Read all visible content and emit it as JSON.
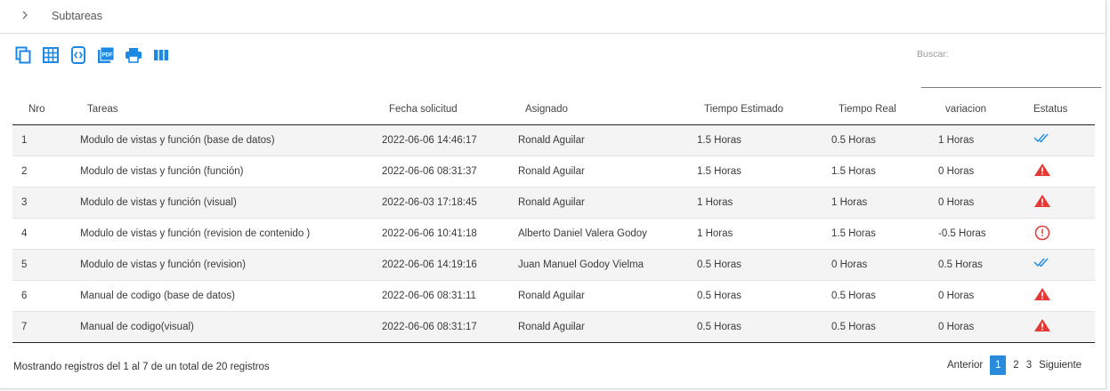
{
  "panel": {
    "title": "Subtareas"
  },
  "toolbar": {
    "buttons": [
      {
        "icon": "copy-icon"
      },
      {
        "icon": "excel-icon"
      },
      {
        "icon": "csv-icon"
      },
      {
        "icon": "pdf-icon"
      },
      {
        "icon": "print-icon"
      },
      {
        "icon": "columns-icon"
      }
    ],
    "accent": "#1e88e5"
  },
  "search": {
    "label": "Buscar:",
    "value": ""
  },
  "table": {
    "headers": [
      "Nro",
      "Tareas",
      "Fecha solicitud",
      "Asignado",
      "Tiempo Estimado",
      "Tiempo Real",
      "variacion",
      "Estatus"
    ],
    "rows": [
      {
        "nro": "1",
        "tarea": "Modulo de vistas y función (base de datos)",
        "fecha": "2022-06-06 14:46:17",
        "asignado": "Ronald Aguilar",
        "estimado": "1.5 Horas",
        "real": "0.5 Horas",
        "variacion": "1 Horas",
        "estatus": "double-check-icon"
      },
      {
        "nro": "2",
        "tarea": "Modulo de vistas y función (función)",
        "fecha": "2022-06-06 08:31:37",
        "asignado": "Ronald Aguilar",
        "estimado": "1.5 Horas",
        "real": "1.5 Horas",
        "variacion": "0 Horas",
        "estatus": "warning-icon"
      },
      {
        "nro": "3",
        "tarea": "Modulo de vistas y función (visual)",
        "fecha": "2022-06-03 17:18:45",
        "asignado": "Ronald Aguilar",
        "estimado": "1 Horas",
        "real": "1 Horas",
        "variacion": "0 Horas",
        "estatus": "warning-icon"
      },
      {
        "nro": "4",
        "tarea": "Modulo de vistas y función (revision de contenido )",
        "fecha": "2022-06-06 10:41:18",
        "asignado": "Alberto Daniel Valera Godoy",
        "estimado": "1 Horas",
        "real": "1.5 Horas",
        "variacion": "-0.5 Horas",
        "estatus": "alert-circle-icon"
      },
      {
        "nro": "5",
        "tarea": "Modulo de vistas y función (revision)",
        "fecha": "2022-06-06 14:19:16",
        "asignado": "Juan Manuel Godoy Vielma",
        "estimado": "0.5 Horas",
        "real": "0 Horas",
        "variacion": "0.5 Horas",
        "estatus": "double-check-icon"
      },
      {
        "nro": "6",
        "tarea": "Manual de codigo (base de datos)",
        "fecha": "2022-06-06 08:31:11",
        "asignado": "Ronald Aguilar",
        "estimado": "0.5 Horas",
        "real": "0.5 Horas",
        "variacion": "0 Horas",
        "estatus": "warning-icon"
      },
      {
        "nro": "7",
        "tarea": "Manual de codigo(visual)",
        "fecha": "2022-06-06 08:31:17",
        "asignado": "Ronald Aguilar",
        "estimado": "0.5 Horas",
        "real": "0.5 Horas",
        "variacion": "0 Horas",
        "estatus": "warning-icon"
      }
    ]
  },
  "footer": {
    "info": "Mostrando registros del 1 al 7 de un total de 20 registros",
    "prev": "Anterior",
    "pages": [
      "1",
      "2",
      "3"
    ],
    "current": "1",
    "next": "Siguiente"
  },
  "colors": {
    "check": "#1e88e5",
    "warning": "#e53935",
    "alert": "#e53935",
    "active_page": "#2a8bdc"
  }
}
